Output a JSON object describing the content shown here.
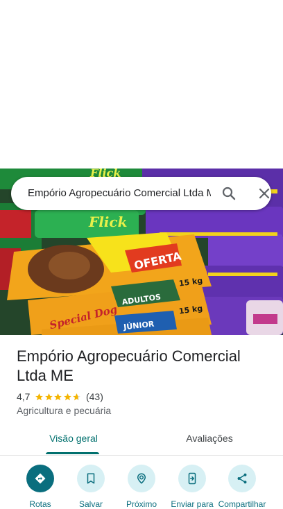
{
  "search": {
    "query": "Empório Agropecuário Comercial Ltda ME"
  },
  "place": {
    "name": "Empório Agropecuário Comercial Ltda ME",
    "rating": "4,7",
    "rating_value": 4.7,
    "review_count": "(43)",
    "category": "Agricultura e pecuária"
  },
  "photo": {
    "labels": {
      "flick_1": "Flick",
      "flick_2": "Flick",
      "oferta": "OFERTA",
      "adultos": "ADULTOS",
      "junior": "JÚNIOR",
      "weight_1": "15 kg",
      "weight_2": "15 kg",
      "special_dog": "Special Dog"
    }
  },
  "tabs": [
    {
      "label": "Visão geral",
      "active": true
    },
    {
      "label": "Avaliações",
      "active": false
    }
  ],
  "actions": [
    {
      "label": "Rotas",
      "icon": "directions-icon"
    },
    {
      "label": "Salvar",
      "icon": "bookmark-icon"
    },
    {
      "label": "Próximo",
      "icon": "nearby-icon"
    },
    {
      "label": "Enviar para",
      "icon": "send-to-phone-icon"
    },
    {
      "label": "Compartilhar",
      "icon": "share-icon"
    }
  ],
  "colors": {
    "accent": "#01706e",
    "action_primary": "#0a6e7e",
    "action_bg": "#d7f0f4",
    "star": "#f4b400"
  }
}
